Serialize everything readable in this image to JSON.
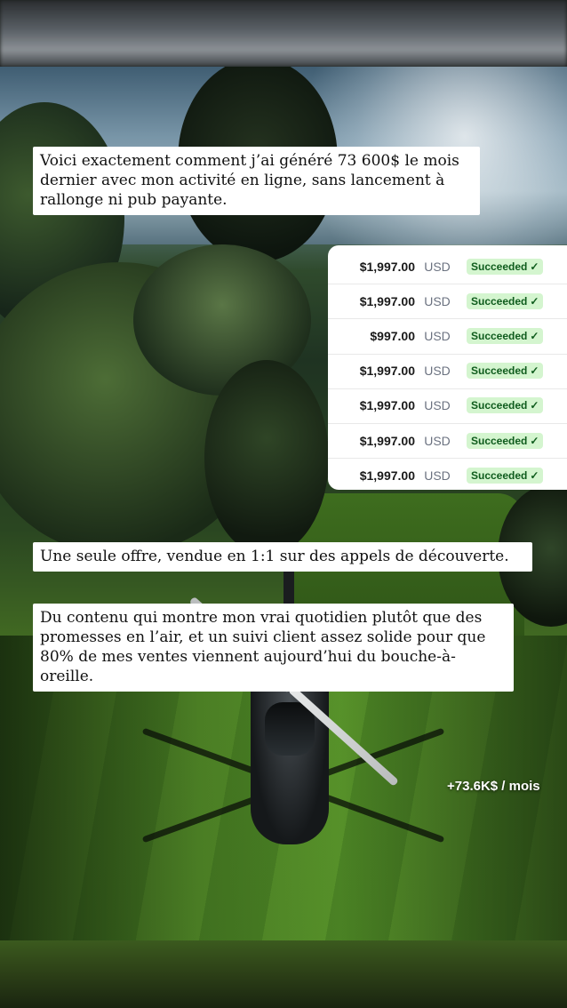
{
  "captions": {
    "intro": "Voici exactement comment j’ai généré 73 600$ le mois dernier avec mon activité en ligne, sans lancement à rallonge ni pub payante.",
    "offer": "Une seule offre, vendue en 1:1 sur des appels de découverte.",
    "content": "Du contenu qui montre mon vrai quotidien plutôt que des promesses en l’air, et un suivi client assez solide pour que 80% de mes ventes viennent aujourd’hui du bouche-à-oreille."
  },
  "payments": [
    {
      "amount": "$1,997.00",
      "currency": "USD",
      "status": "Succeeded",
      "status_icon": "check-icon"
    },
    {
      "amount": "$1,997.00",
      "currency": "USD",
      "status": "Succeeded",
      "status_icon": "check-icon"
    },
    {
      "amount": "$997.00",
      "currency": "USD",
      "status": "Succeeded",
      "status_icon": "check-icon"
    },
    {
      "amount": "$1,997.00",
      "currency": "USD",
      "status": "Succeeded",
      "status_icon": "check-icon"
    },
    {
      "amount": "$1,997.00",
      "currency": "USD",
      "status": "Succeeded",
      "status_icon": "check-icon"
    },
    {
      "amount": "$1,997.00",
      "currency": "USD",
      "status": "Succeeded",
      "status_icon": "check-icon"
    },
    {
      "amount": "$1,997.00",
      "currency": "USD",
      "status": "Succeeded",
      "status_icon": "check-icon"
    }
  ],
  "overlay": {
    "monthly_stat": "+73.6K$ / mois"
  },
  "colors": {
    "badge_bg": "#d4f5cf",
    "badge_text": "#0f5c1d",
    "caption_bg": "#ffffff"
  }
}
